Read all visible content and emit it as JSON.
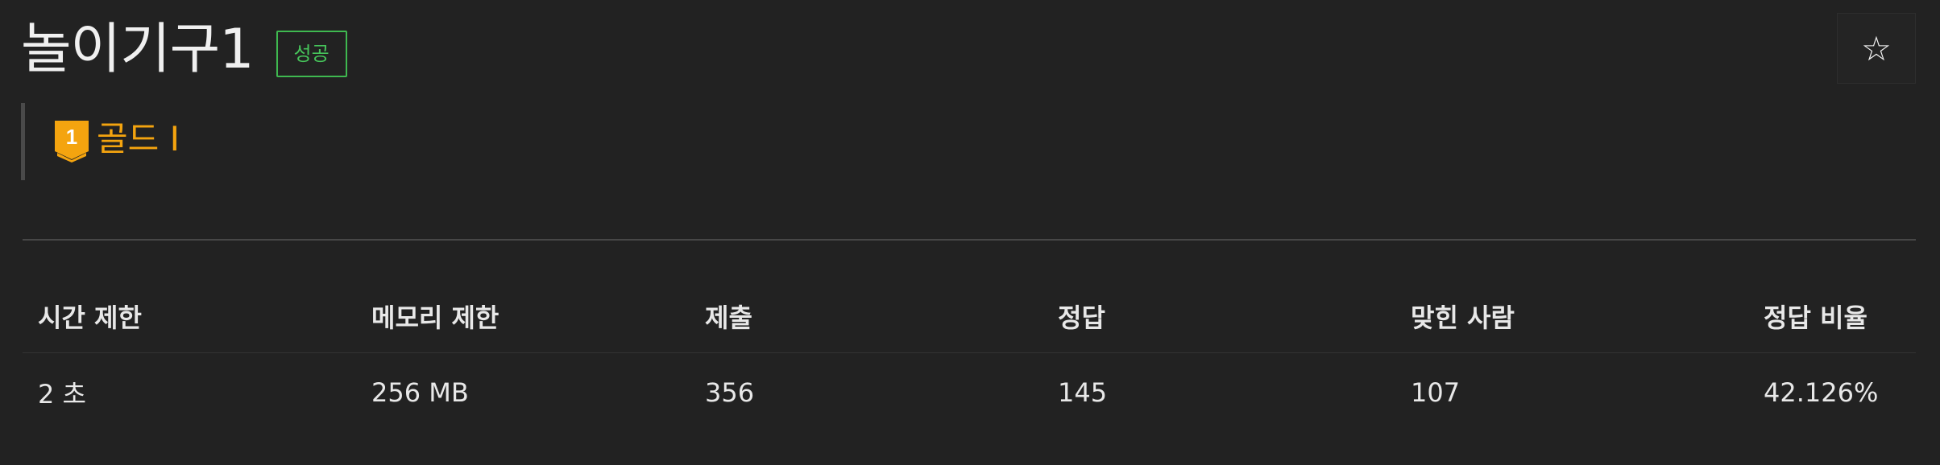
{
  "problem": {
    "title": "놀이기구1",
    "status_badge": "성공",
    "star_glyph": "☆"
  },
  "tier": {
    "label": "골드 I",
    "number": "1",
    "color": "#f4a40f",
    "icon": "gold-tier-icon"
  },
  "info_table": {
    "headers": [
      "시간 제한",
      "메모리 제한",
      "제출",
      "정답",
      "맞힌 사람",
      "정답 비율"
    ],
    "values": [
      "2 초",
      "256 MB",
      "356",
      "145",
      "107",
      "42.126%"
    ]
  },
  "colors": {
    "background": "#222222",
    "success": "#46c35a",
    "gold": "#f4a40f"
  }
}
